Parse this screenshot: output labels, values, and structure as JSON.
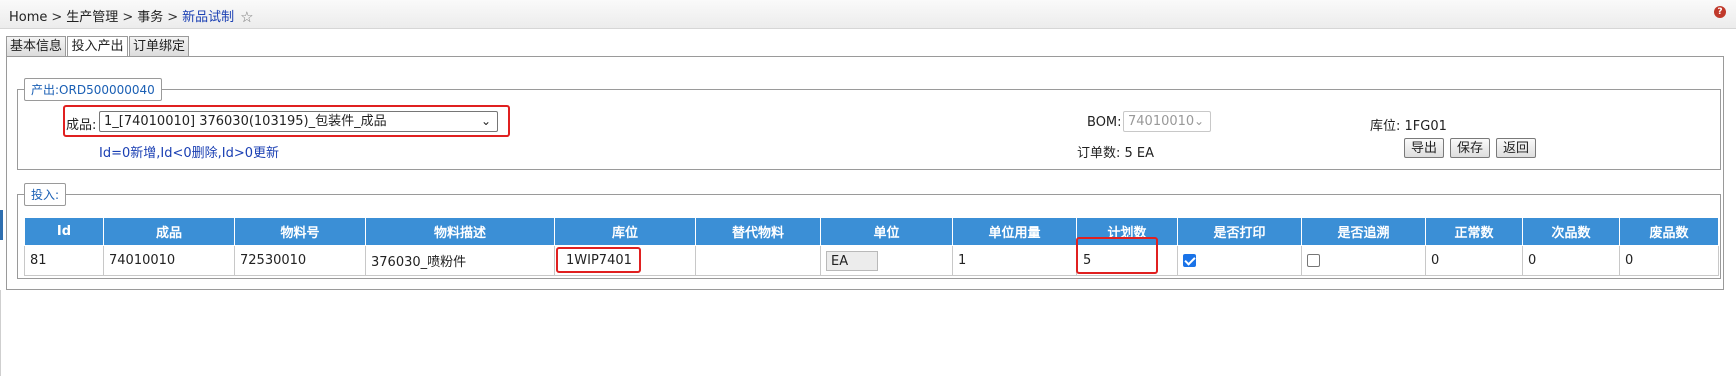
{
  "breadcrumb": {
    "home": "Home",
    "sep": ">",
    "level1": "生产管理",
    "level2": "事务",
    "current": "新品试制"
  },
  "tabs": [
    {
      "label": "基本信息",
      "active": false
    },
    {
      "label": "投入产出",
      "active": true
    },
    {
      "label": "订单绑定",
      "active": false
    }
  ],
  "output": {
    "legend": "产出:ORD500000040",
    "product_label": "成品:",
    "product_value": "1_[74010010] 376030(103195)_包装件_成品",
    "hint": "Id=0新增,Id<0删除,Id>0更新",
    "bom_label": "BOM:",
    "bom_value": "74010010",
    "order_qty": "订单数: 5 EA",
    "location": "库位: 1FG01",
    "buttons": {
      "export": "导出",
      "save": "保存",
      "back": "返回"
    }
  },
  "input": {
    "legend": "投入:",
    "columns": [
      "Id",
      "成品",
      "物料号",
      "物料描述",
      "库位",
      "替代物料",
      "单位",
      "单位用量",
      "计划数",
      "是否打印",
      "是否追溯",
      "正常数",
      "次品数",
      "废品数"
    ],
    "rows": [
      {
        "id": "81",
        "product": "74010010",
        "material_no": "72530010",
        "description": "376030_喷粉件",
        "location": "1WIP7401",
        "substitute": "",
        "unit": "EA",
        "unit_qty": "1",
        "planned": "5",
        "print": true,
        "trace": false,
        "normal": "0",
        "defective": "0",
        "scrap": "0"
      }
    ]
  },
  "colors": {
    "header_blue": "#3b8fd6",
    "highlight_red": "#e02020",
    "link_blue": "#1a3fb3"
  }
}
